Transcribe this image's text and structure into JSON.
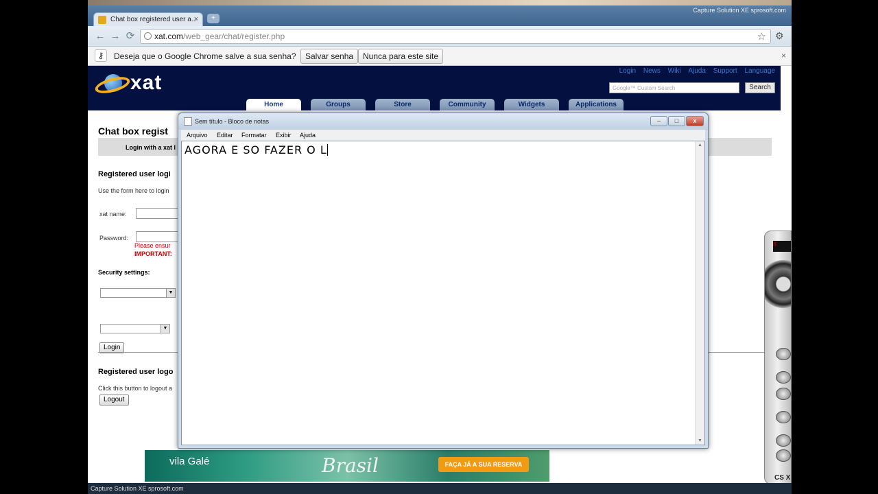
{
  "browser": {
    "tab_title": "Chat box registered user a...",
    "tab_close": "×",
    "new_tab": "+",
    "tray_text": "Capture Solution XE sprosoft.com",
    "url_host": "xat.com",
    "url_path": "/web_gear/chat/register.php",
    "back": "←",
    "forward": "→",
    "reload": "⟳",
    "star": "☆",
    "wrench": "🔧"
  },
  "infobar": {
    "message": "Deseja que o Google Chrome salve a sua senha?",
    "save_label": "Salvar senha",
    "never_label": "Nunca para este site",
    "close": "×",
    "key": "⚷"
  },
  "xat": {
    "logo_text": "xat",
    "toplinks": [
      "Login",
      "News",
      "Wiki",
      "Ajuda",
      "Support",
      "Language"
    ],
    "search_placeholder": "Google™ Custom Search",
    "search_button": "Search",
    "tabs": [
      "Home",
      "Groups",
      "Store",
      "Community",
      "Widgets",
      "Applications"
    ],
    "page_title": "Chat box regist",
    "login_bar_text": "Login with a xat l",
    "section_login": "Registered user logi",
    "login_desc": "Use the form here to login",
    "xat_name_label": "xat name:",
    "password_label": "Password:",
    "warning_1": "Please ensur",
    "warning_2": "IMPORTANT: ",
    "security_label": "Security settings:",
    "login_button": "Login",
    "section_logout": "Registered user logo",
    "logout_desc": "Click this button to logout a",
    "logout_button": "Logout"
  },
  "banner": {
    "vila": "vila Galé",
    "brasil": "Brasil",
    "cta": "FAÇA JÁ A SUA RESERVA"
  },
  "notepad": {
    "title": "Sem título - Bloco de notas",
    "menu": [
      "Arquivo",
      "Editar",
      "Formatar",
      "Exibir",
      "Ajuda"
    ],
    "content": "AGORA E SO FAZER O L",
    "minimize": "–",
    "maximize": "□",
    "close": "x"
  },
  "capture": {
    "label": "CS X",
    "display": "8"
  },
  "status_bottom": "Capture Solution XE sprosoft.com"
}
